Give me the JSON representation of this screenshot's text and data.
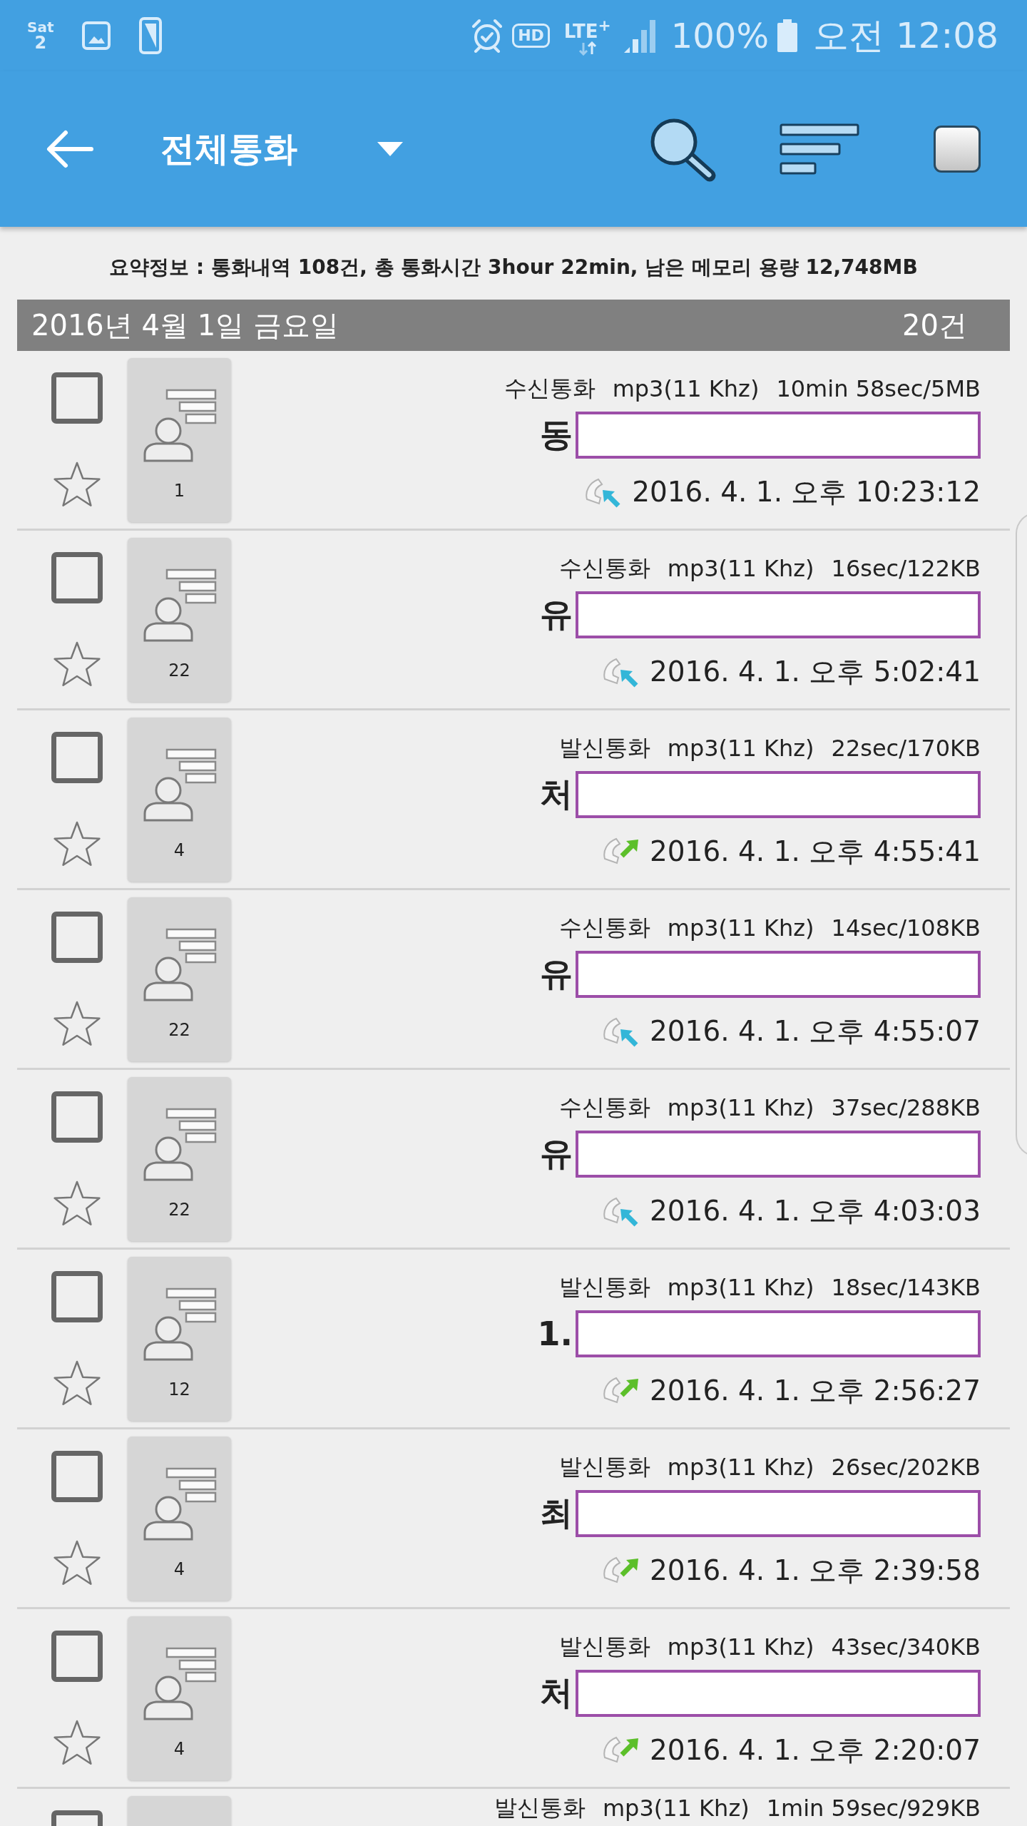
{
  "status_bar": {
    "weekday": "Sat",
    "day": "2",
    "hd": "HD",
    "network": "LTE$^{+}$",
    "battery": "100%",
    "time": "오전 12:08"
  },
  "app_bar": {
    "title": "전체통화",
    "select_all_checked": false
  },
  "summary": "요약정보 : 통화내역 108건, 총 통화시간 3hour 22min, 남은 메모리 용량 12,748MB",
  "groups": [
    {
      "date": "2016년 4월 1일 금요일",
      "count": "20건",
      "calls": [
        {
          "kind": "incoming",
          "type_label": "수신통화",
          "format": "mp3(11 Khz)",
          "duration_size": "10min 58sec/5MB",
          "name": "동",
          "redacted": true,
          "datetime": "2016. 4. 1. 오후 10:23:12",
          "contacts": "1",
          "checked": false,
          "starred": false
        },
        {
          "kind": "incoming",
          "type_label": "수신통화",
          "format": "mp3(11 Khz)",
          "duration_size": "16sec/122KB",
          "name": "유",
          "redacted": true,
          "datetime": "2016. 4. 1. 오후 5:02:41",
          "contacts": "22",
          "checked": false,
          "starred": false
        },
        {
          "kind": "outgoing",
          "type_label": "발신통화",
          "format": "mp3(11 Khz)",
          "duration_size": "22sec/170KB",
          "name": "처",
          "redacted": true,
          "datetime": "2016. 4. 1. 오후 4:55:41",
          "contacts": "4",
          "checked": false,
          "starred": false
        },
        {
          "kind": "incoming",
          "type_label": "수신통화",
          "format": "mp3(11 Khz)",
          "duration_size": "14sec/108KB",
          "name": "유",
          "redacted": true,
          "datetime": "2016. 4. 1. 오후 4:55:07",
          "contacts": "22",
          "checked": false,
          "starred": false
        },
        {
          "kind": "incoming",
          "type_label": "수신통화",
          "format": "mp3(11 Khz)",
          "duration_size": "37sec/288KB",
          "name": "유",
          "redacted": true,
          "datetime": "2016. 4. 1. 오후 4:03:03",
          "contacts": "22",
          "checked": false,
          "starred": false
        },
        {
          "kind": "outgoing",
          "type_label": "발신통화",
          "format": "mp3(11 Khz)",
          "duration_size": "18sec/143KB",
          "name": "1.",
          "redacted": true,
          "datetime": "2016. 4. 1. 오후 2:56:27",
          "contacts": "12",
          "checked": false,
          "starred": false
        },
        {
          "kind": "outgoing",
          "type_label": "발신통화",
          "format": "mp3(11 Khz)",
          "duration_size": "26sec/202KB",
          "name": "최",
          "redacted": true,
          "datetime": "2016. 4. 1. 오후 2:39:58",
          "contacts": "4",
          "checked": false,
          "starred": false
        },
        {
          "kind": "outgoing",
          "type_label": "발신통화",
          "format": "mp3(11 Khz)",
          "duration_size": "43sec/340KB",
          "name": "처",
          "redacted": true,
          "datetime": "2016. 4. 1. 오후 2:20:07",
          "contacts": "4",
          "checked": false,
          "starred": false
        },
        {
          "type_label": "발신통화",
          "format": "mp3(11 Khz)",
          "duration_size": "1min 59sec/929KB",
          "checked": false
        }
      ]
    }
  ]
}
